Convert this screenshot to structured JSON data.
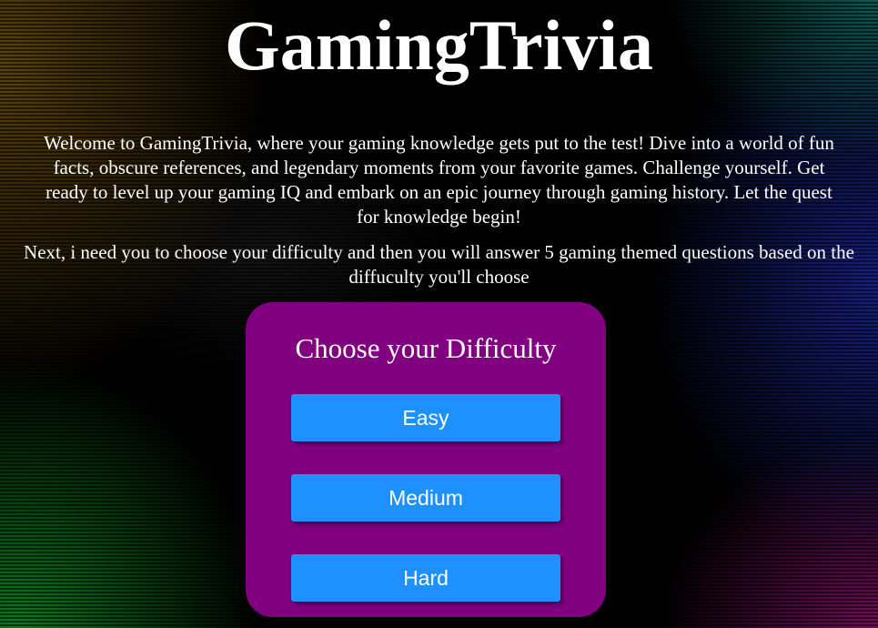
{
  "header": {
    "title": "GamingTrivia"
  },
  "intro": {
    "text": "Welcome to GamingTrivia, where your gaming knowledge gets put to the test! Dive into a world of fun facts, obscure references, and legendary moments from your favorite games. Challenge yourself. Get ready to level up your gaming IQ and embark on an epic journey through gaming history. Let the quest for knowledge begin!",
    "instructions": "Next, i need you to choose your difficulty and then you will answer 5 gaming themed questions based on the diffuculty you'll choose"
  },
  "difficulty": {
    "heading": "Choose your Difficulty",
    "buttons": [
      {
        "label": "Easy"
      },
      {
        "label": "Medium"
      },
      {
        "label": "Hard"
      }
    ]
  },
  "colors": {
    "card_background": "#800080",
    "button_background": "#1e90ff",
    "text": "#ffffff",
    "page_background": "#000000"
  }
}
